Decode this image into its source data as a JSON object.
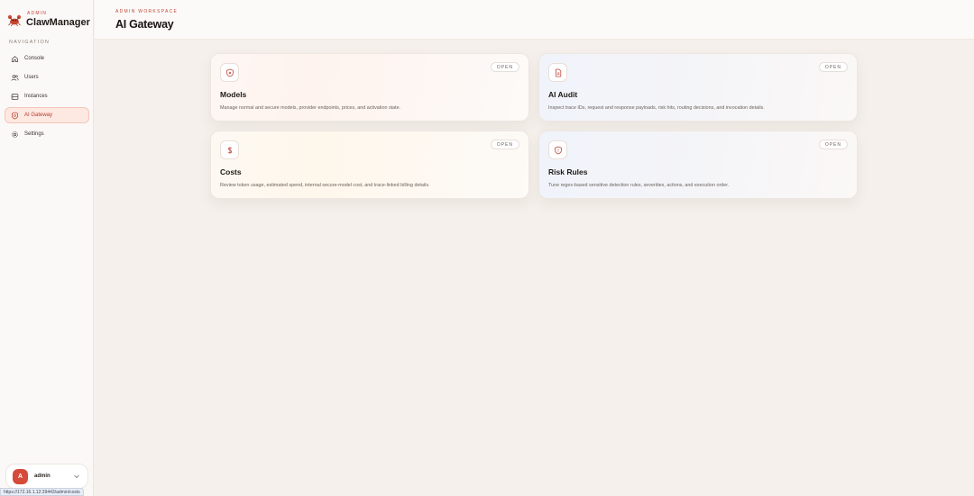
{
  "brand": {
    "kicker": "ADMIN",
    "name": "ClawManager",
    "logo_icon": "crab-logo-icon"
  },
  "sidebar": {
    "heading": "NAVIGATION",
    "items": [
      {
        "label": "Console",
        "icon": "home-icon",
        "active": false
      },
      {
        "label": "Users",
        "icon": "users-icon",
        "active": false
      },
      {
        "label": "Instances",
        "icon": "server-icon",
        "active": false
      },
      {
        "label": "AI Gateway",
        "icon": "shield-icon",
        "active": true
      },
      {
        "label": "Settings",
        "icon": "gear-icon",
        "active": false
      }
    ],
    "user": {
      "initial": "A",
      "name": "admin"
    },
    "status_url": "https://172.16.1.12:39443/admin/costs"
  },
  "header": {
    "kicker": "ADMIN WORKSPACE",
    "title": "AI Gateway"
  },
  "cards": [
    {
      "title": "Models",
      "badge": "OPEN",
      "icon": "shield-icon",
      "description": "Manage normal and secure models, provider endpoints, prices, and activation state."
    },
    {
      "title": "AI Audit",
      "badge": "OPEN",
      "icon": "document-icon",
      "description": "Inspect trace IDs, request and response payloads, risk hits, routing decisions, and invocation details."
    },
    {
      "title": "Costs",
      "badge": "OPEN",
      "icon": "dollar-icon",
      "description": "Review token usage, estimated spend, internal secure-model cost, and trace-linked billing details."
    },
    {
      "title": "Risk Rules",
      "badge": "OPEN",
      "icon": "shield-icon",
      "description": "Tune regex-based sensitive detection rules, severities, actions, and execution order."
    }
  ],
  "colors": {
    "accent": "#c0463a",
    "avatar": "#d64a3a",
    "active_bg": "#fde9e2"
  }
}
